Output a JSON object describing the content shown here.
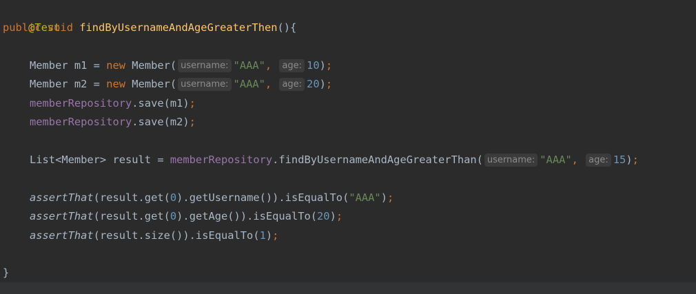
{
  "code": {
    "annotation": "@Test",
    "l2": {
      "kw1": "public",
      "kw2": "void",
      "method": "findByUsernameAndAgeGreaterThen",
      "rest": "(){"
    },
    "l4": {
      "type": "Member",
      "var": " m1 = ",
      "new": "new",
      "ctor": " Member(",
      "hint_username": "username:",
      "str": "\"AAA\"",
      "comma": ", ",
      "hint_age": "age:",
      "num": "10",
      "close": ")",
      "semi": ";"
    },
    "l5": {
      "type": "Member",
      "var": " m2 = ",
      "new": "new",
      "ctor": " Member(",
      "hint_username": "username:",
      "str": "\"AAA\"",
      "comma": ", ",
      "hint_age": "age:",
      "num": "20",
      "close": ")",
      "semi": ";"
    },
    "l6": {
      "field": "memberRepository",
      "call": ".save(m1)",
      "semi": ";"
    },
    "l7": {
      "field": "memberRepository",
      "call": ".save(m2)",
      "semi": ";"
    },
    "l9": {
      "pre": "List<Member> result = ",
      "field": "memberRepository",
      "call": ".findByUsernameAndAgeGreaterThan(",
      "hint_username": "username:",
      "str": "\"AAA\"",
      "comma": ", ",
      "hint_age": "age:",
      "num": "15",
      "close": ")",
      "semi": ";"
    },
    "l11": {
      "fn": "assertThat",
      "a": "(result.get(",
      "n1": "0",
      "b": ").getUsername()).isEqualTo(",
      "str": "\"AAA\"",
      "close": ")",
      "semi": ";"
    },
    "l12": {
      "fn": "assertThat",
      "a": "(result.get(",
      "n1": "0",
      "b": ").getAge()).isEqualTo(",
      "n2": "20",
      "close": ")",
      "semi": ";"
    },
    "l13": {
      "fn": "assertThat",
      "a": "(result.size()).isEqualTo(",
      "n1": "1",
      "close": ")",
      "semi": ";"
    },
    "l15": "}"
  },
  "colors": {
    "background": "#2b2b2b",
    "text": "#a9b7c6",
    "keyword": "#cc7832",
    "annotation": "#bbb529",
    "method": "#ffc66d",
    "field": "#9876aa",
    "string": "#6a8759",
    "number": "#6897bb",
    "hint": "#8c8c8c"
  }
}
